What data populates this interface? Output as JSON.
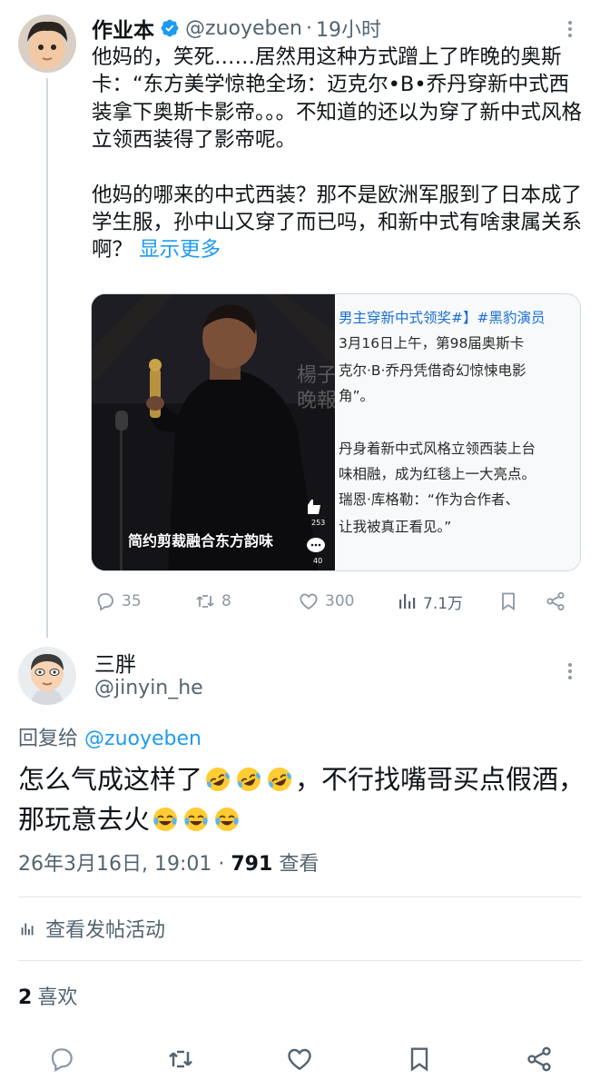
{
  "parent": {
    "name": "作业本",
    "handle": "@zuoyeben",
    "separator": "·",
    "time": "19小时",
    "text_para1": "他妈的，笑死……居然用这种方式蹭上了昨晚的奥斯卡：“东方美学惊艳全场：迈克尔•B•乔丹穿新中式西装拿下奥斯卡影帝。。。不知道的还以为穿了新中式风格立领西装得了影帝呢。",
    "text_para2": "他妈的哪来的中式西装？那不是欧洲军服到了日本成了学生服，孙中山又穿了而已吗，和新中式有啥隶属关系啊？",
    "show_more": "显示更多",
    "media": {
      "photo_caption": "简约剪裁融合东方韵味",
      "video_like_count": "253",
      "video_comment_count": "40",
      "article_lines": [
        "男主穿新中式领奖#】#黑豹演员",
        "3月16日上午，第98届奥斯卡",
        "克尔·B·乔丹凭借奇幻惊悚电影",
        "角”。",
        "丹身着新中式风格立领西装上台",
        "味相融，成为红毯上一大亮点。",
        "瑞恩·库格勒：“作为合作者、",
        "让我被真正看见。”"
      ]
    },
    "actions": {
      "replies": "35",
      "reposts": "8",
      "likes": "300",
      "views": "7.1万"
    }
  },
  "reply": {
    "name": "三胖",
    "handle": "@jinyin_he",
    "reply_to_label": "回复给",
    "reply_to_handle": "@zuoyeben",
    "text_part1": "怎么气成这样了",
    "text_part2": "，不行找嘴哥买点假酒，那玩意去火",
    "emoji_rolling_laughing": "rolling-on-floor-laughing",
    "emoji_tears_of_joy": "face-with-tears-of-joy",
    "timestamp": "26年3月16日, 19:01",
    "separator": "·",
    "view_count": "791",
    "view_label": "查看",
    "activity_label": "查看发帖活动",
    "like_count": "2",
    "like_label": "喜欢"
  },
  "colors": {
    "accent": "#1d9bf0",
    "secondary_text": "#536471",
    "icon_gray": "#8b98a5",
    "divider": "#dfe5e9"
  },
  "icons": [
    "verified-badge-icon",
    "more-icon",
    "reply-icon",
    "repost-icon",
    "like-icon",
    "views-icon",
    "bookmark-icon",
    "share-icon",
    "analytics-icon"
  ]
}
